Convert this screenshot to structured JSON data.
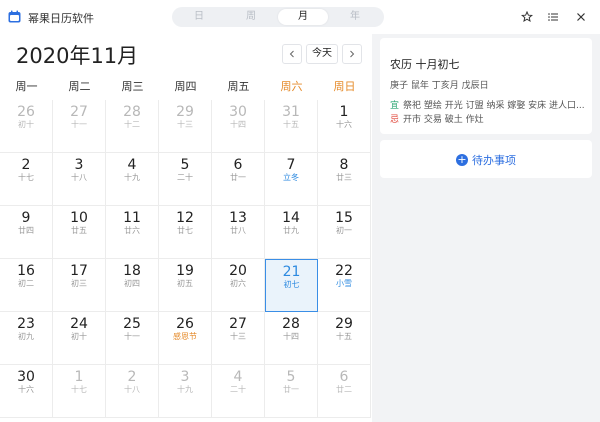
{
  "app": {
    "title": "幂果日历软件"
  },
  "view_tabs": [
    {
      "label": "日",
      "active": false
    },
    {
      "label": "周",
      "active": false
    },
    {
      "label": "月",
      "active": true
    },
    {
      "label": "年",
      "active": false
    }
  ],
  "header": {
    "month_title": "2020年11月",
    "today_label": "今天"
  },
  "weekdays": [
    "周一",
    "周二",
    "周三",
    "周四",
    "周五",
    "周六",
    "周日"
  ],
  "weeks": [
    [
      {
        "day": "26",
        "lunar": "初十",
        "dim": true
      },
      {
        "day": "27",
        "lunar": "十一",
        "dim": true
      },
      {
        "day": "28",
        "lunar": "十二",
        "dim": true
      },
      {
        "day": "29",
        "lunar": "十三",
        "dim": true
      },
      {
        "day": "30",
        "lunar": "十四",
        "dim": true
      },
      {
        "day": "31",
        "lunar": "十五",
        "dim": true
      },
      {
        "day": "1",
        "lunar": "十六"
      }
    ],
    [
      {
        "day": "2",
        "lunar": "十七"
      },
      {
        "day": "3",
        "lunar": "十八"
      },
      {
        "day": "4",
        "lunar": "十九"
      },
      {
        "day": "5",
        "lunar": "二十"
      },
      {
        "day": "6",
        "lunar": "廿一"
      },
      {
        "day": "7",
        "lunar": "立冬",
        "style": "term"
      },
      {
        "day": "8",
        "lunar": "廿三"
      }
    ],
    [
      {
        "day": "9",
        "lunar": "廿四"
      },
      {
        "day": "10",
        "lunar": "廿五"
      },
      {
        "day": "11",
        "lunar": "廿六"
      },
      {
        "day": "12",
        "lunar": "廿七"
      },
      {
        "day": "13",
        "lunar": "廿八"
      },
      {
        "day": "14",
        "lunar": "廿九"
      },
      {
        "day": "15",
        "lunar": "初一"
      }
    ],
    [
      {
        "day": "16",
        "lunar": "初二"
      },
      {
        "day": "17",
        "lunar": "初三"
      },
      {
        "day": "18",
        "lunar": "初四"
      },
      {
        "day": "19",
        "lunar": "初五"
      },
      {
        "day": "20",
        "lunar": "初六"
      },
      {
        "day": "21",
        "lunar": "初七",
        "selected": true
      },
      {
        "day": "22",
        "lunar": "小雪",
        "style": "term"
      }
    ],
    [
      {
        "day": "23",
        "lunar": "初九"
      },
      {
        "day": "24",
        "lunar": "初十"
      },
      {
        "day": "25",
        "lunar": "十一"
      },
      {
        "day": "26",
        "lunar": "感恩节",
        "style": "fest"
      },
      {
        "day": "27",
        "lunar": "十三"
      },
      {
        "day": "28",
        "lunar": "十四"
      },
      {
        "day": "29",
        "lunar": "十五"
      }
    ],
    [
      {
        "day": "30",
        "lunar": "十六"
      },
      {
        "day": "1",
        "lunar": "十七",
        "dim": true
      },
      {
        "day": "2",
        "lunar": "十八",
        "dim": true
      },
      {
        "day": "3",
        "lunar": "十九",
        "dim": true
      },
      {
        "day": "4",
        "lunar": "二十",
        "dim": true
      },
      {
        "day": "5",
        "lunar": "廿一",
        "dim": true
      },
      {
        "day": "6",
        "lunar": "廿二",
        "dim": true
      }
    ]
  ],
  "detail": {
    "lunar_date": "农历 十月初七",
    "ganzhi": "庚子 鼠年 丁亥月 戊辰日",
    "yi_tag": "宜",
    "yi_text": "祭祀 塑绘 开光 订盟 纳采 嫁娶 安床 进人口...",
    "ji_tag": "忌",
    "ji_text": "开市 交易 破土 作灶"
  },
  "todo": {
    "plus": "+",
    "label": "待办事项"
  },
  "colors": {
    "accent": "#2d8ae0",
    "weekend": "#e58a29",
    "yi": "#2aa672",
    "ji": "#e0463a"
  }
}
